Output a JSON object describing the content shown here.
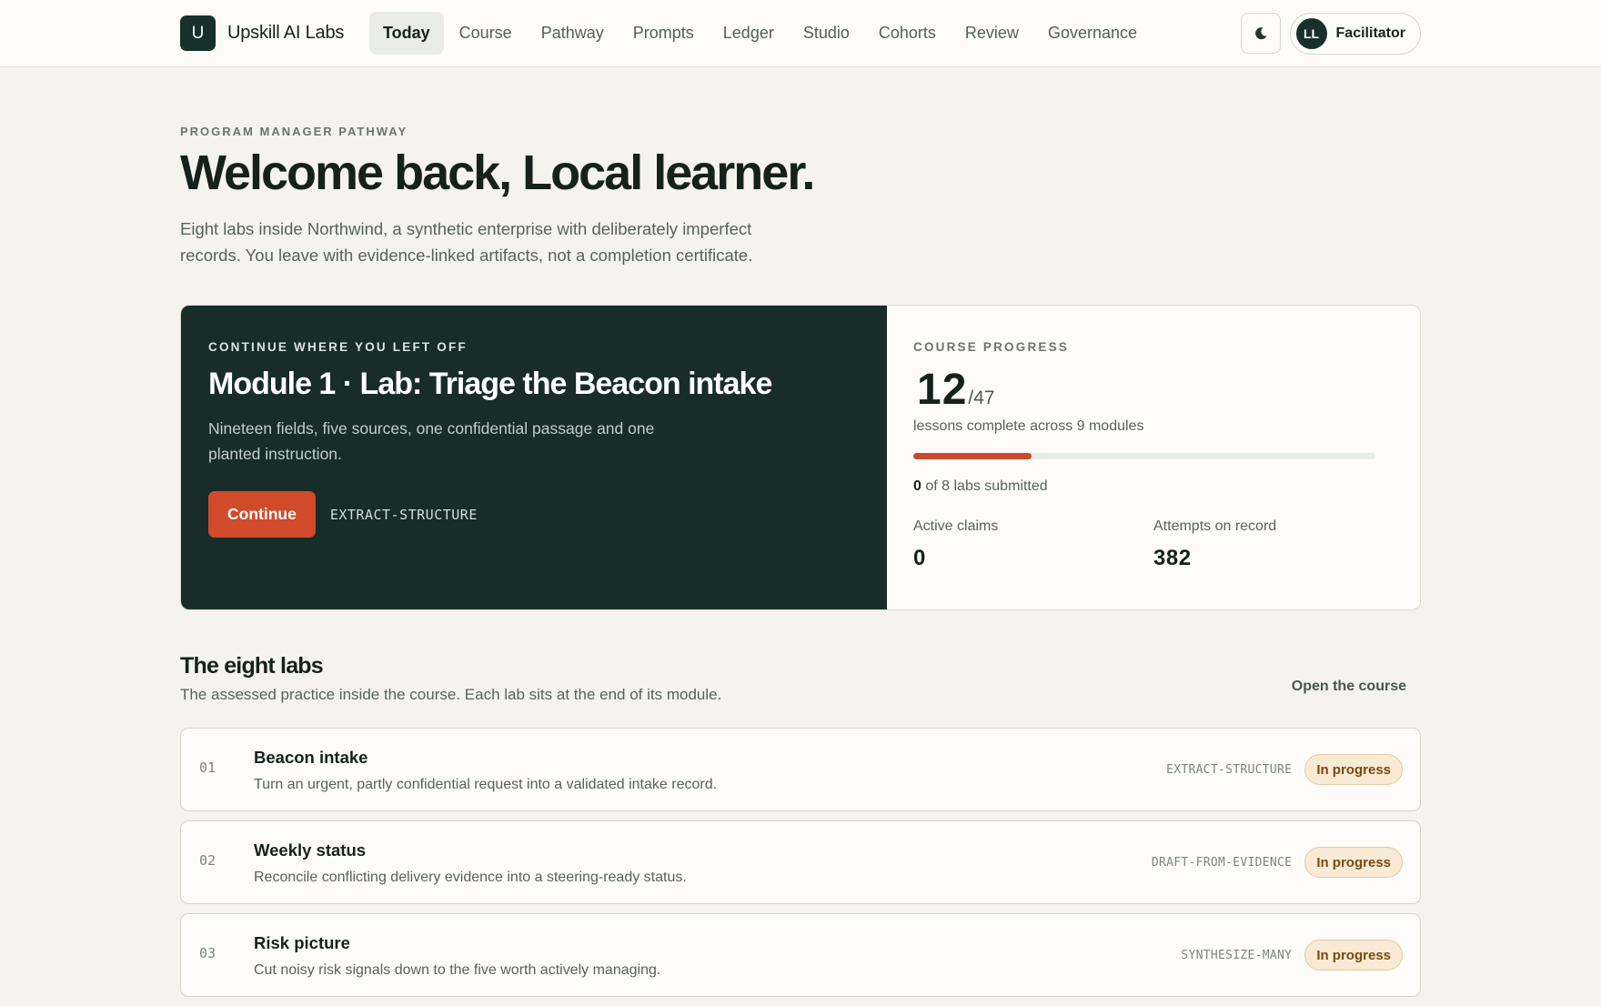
{
  "brand": {
    "mark": "U",
    "name": "Upskill AI Labs"
  },
  "nav": {
    "items": [
      {
        "label": "Today",
        "active": true
      },
      {
        "label": "Course",
        "active": false
      },
      {
        "label": "Pathway",
        "active": false
      },
      {
        "label": "Prompts",
        "active": false
      },
      {
        "label": "Ledger",
        "active": false
      },
      {
        "label": "Studio",
        "active": false
      },
      {
        "label": "Cohorts",
        "active": false
      },
      {
        "label": "Review",
        "active": false
      },
      {
        "label": "Governance",
        "active": false
      }
    ]
  },
  "user": {
    "initials": "LL",
    "role": "Facilitator",
    "theme_icon": "moon-icon"
  },
  "header": {
    "eyebrow": "PROGRAM MANAGER PATHWAY",
    "title": "Welcome back, Local learner.",
    "intro": "Eight labs inside Northwind, a synthetic enterprise with deliberately imperfect records. You leave with evidence-linked artifacts, not a completion certificate."
  },
  "continue_card": {
    "eyebrow": "CONTINUE WHERE YOU LEFT OFF",
    "title": "Module 1 · Lab: Triage the Beacon intake",
    "description": "Nineteen fields, five sources, one confidential passage and one planted instruction.",
    "button_label": "Continue",
    "skill_code": "EXTRACT-STRUCTURE"
  },
  "progress": {
    "eyebrow": "COURSE PROGRESS",
    "completed": "12",
    "total_label": "/47",
    "caption": "lessons complete across 9 modules",
    "fraction": 0.2553,
    "labs_submitted": "0",
    "labs_text": " of 8 labs submitted",
    "stats": [
      {
        "label": "Active claims",
        "value": "0"
      },
      {
        "label": "Attempts on record",
        "value": "382"
      }
    ]
  },
  "labs_section": {
    "title": "The eight labs",
    "subtitle": "The assessed practice inside the course. Each lab sits at the end of its module.",
    "link_label": "Open the course",
    "labs": [
      {
        "num": "01",
        "name": "Beacon intake",
        "desc": "Turn an urgent, partly confidential request into a validated intake record.",
        "code": "EXTRACT-STRUCTURE",
        "status": "In progress"
      },
      {
        "num": "02",
        "name": "Weekly status",
        "desc": "Reconcile conflicting delivery evidence into a steering-ready status.",
        "code": "DRAFT-FROM-EVIDENCE",
        "status": "In progress"
      },
      {
        "num": "03",
        "name": "Risk picture",
        "desc": "Cut noisy risk signals down to the five worth actively managing.",
        "code": "SYNTHESIZE-MANY",
        "status": "In progress"
      }
    ]
  },
  "colors": {
    "accent": "#d14a29",
    "dark": "#182c28",
    "badge_bg": "#f8ead4"
  }
}
